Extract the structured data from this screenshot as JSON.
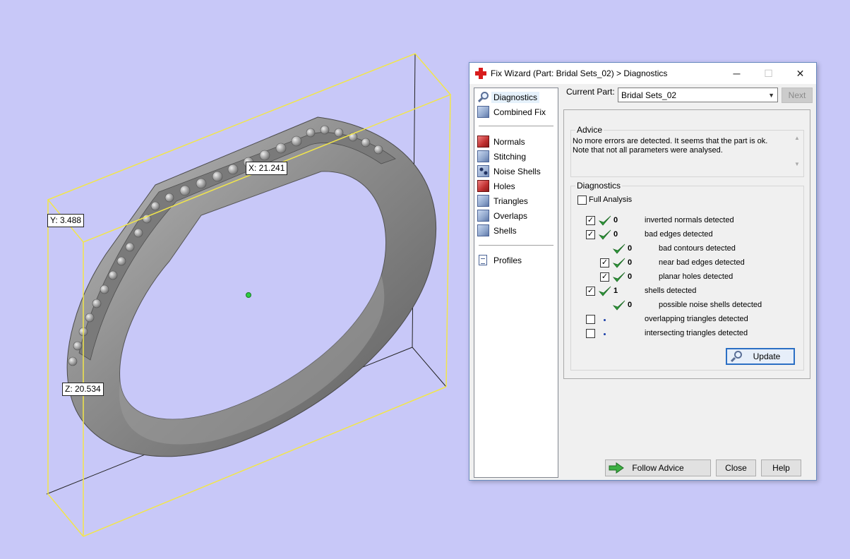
{
  "viewport": {
    "labels": {
      "x": "X: 21.241",
      "y": "Y: 3.488",
      "z": "Z: 20.534"
    },
    "colors": {
      "background": "#c8c8f8",
      "bounding_box": "#f2e64a",
      "model": "#8a8a8a"
    }
  },
  "dialog": {
    "title": "Fix Wizard (Part: Bridal Sets_02) > Diagnostics",
    "window_buttons": {
      "minimize": "─",
      "maximize": "☐",
      "close": "✕"
    },
    "nav": {
      "items": [
        {
          "label": "Diagnostics",
          "icon": "magnifier-icon"
        },
        {
          "label": "Combined Fix",
          "icon": "cube-icon"
        },
        {
          "label": "Normals",
          "icon": "normals-cube-icon"
        },
        {
          "label": "Stitching",
          "icon": "stitching-cube-icon"
        },
        {
          "label": "Noise Shells",
          "icon": "noise-shells-icon"
        },
        {
          "label": "Holes",
          "icon": "holes-cube-icon"
        },
        {
          "label": "Triangles",
          "icon": "triangles-cube-icon"
        },
        {
          "label": "Overlaps",
          "icon": "overlaps-cube-icon"
        },
        {
          "label": "Shells",
          "icon": "shells-cube-icon"
        },
        {
          "label": "Profiles",
          "icon": "document-icon"
        }
      ]
    },
    "current_part": {
      "label": "Current Part:",
      "value": "Bridal Sets_02"
    },
    "next_label": "Next",
    "advice": {
      "title": "Advice",
      "line1": "No more errors are detected. It seems that the part is ok.",
      "line2": "Note that not all parameters were analysed."
    },
    "diagnostics": {
      "title": "Diagnostics",
      "full_analysis": {
        "label": "Full Analysis",
        "checked": false
      },
      "rows": [
        {
          "checked": true,
          "count": "0",
          "label": "inverted normals detected"
        },
        {
          "checked": true,
          "count": "0",
          "label": "bad edges detected"
        },
        {
          "checked": null,
          "count": "0",
          "label": "bad contours detected"
        },
        {
          "checked": true,
          "count": "0",
          "label": "near bad edges detected"
        },
        {
          "checked": true,
          "count": "0",
          "label": "planar holes detected"
        },
        {
          "checked": true,
          "count": "1",
          "label": "shells detected"
        },
        {
          "checked": null,
          "count": "0",
          "label": "possible noise shells detected"
        },
        {
          "checked": false,
          "count": "",
          "label": "overlapping triangles detected"
        },
        {
          "checked": false,
          "count": "",
          "label": "intersecting triangles detected"
        }
      ],
      "update_label": "Update"
    },
    "buttons": {
      "follow_advice": "Follow Advice",
      "close": "Close",
      "help": "Help"
    }
  }
}
